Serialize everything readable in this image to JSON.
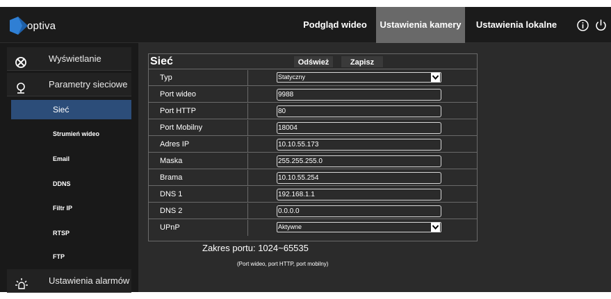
{
  "brand": {
    "name": "optiva",
    "accent": "#2f7fd4"
  },
  "nav": {
    "tabs": [
      {
        "label": "Podgląd wideo",
        "active": false
      },
      {
        "label": "Ustawienia kamery",
        "active": true
      },
      {
        "label": "Ustawienia lokalne",
        "active": false
      }
    ],
    "icons": [
      "info-icon",
      "power-icon"
    ]
  },
  "sidebar": {
    "display": {
      "label": "Wyświetlanie",
      "icon": "aperture-icon"
    },
    "network": {
      "label": "Parametry sieciowe",
      "icon": "globe-icon"
    },
    "sub_items": [
      {
        "label": "Sieć",
        "active": true
      },
      {
        "label": "Strumień wideo"
      },
      {
        "label": "Email"
      },
      {
        "label": "DDNS"
      },
      {
        "label": "Filtr IP"
      },
      {
        "label": "RTSP"
      },
      {
        "label": "FTP"
      }
    ],
    "alarms": {
      "label": "Ustawienia alarmów",
      "icon": "alarm-bulb-icon"
    }
  },
  "form": {
    "title": "Sieć",
    "refresh_label": "Odśwież",
    "save_label": "Zapisz",
    "fields": [
      {
        "label": "Typ",
        "value": "Statyczny",
        "kind": "select"
      },
      {
        "label": "Port wideo",
        "value": "9988"
      },
      {
        "label": "Port HTTP",
        "value": "80"
      },
      {
        "label": "Port Mobilny",
        "value": "18004"
      },
      {
        "label": "Adres IP",
        "value": "10.10.55.173"
      },
      {
        "label": "Maska",
        "value": "255.255.255.0"
      },
      {
        "label": "Brama",
        "value": "10.10.55.254"
      },
      {
        "label": "DNS 1",
        "value": "192.168.1.1"
      },
      {
        "label": "DNS 2",
        "value": "0.0.0.0"
      },
      {
        "label": "UPnP",
        "value": "Aktywne",
        "kind": "select"
      }
    ]
  },
  "notes": {
    "port_range": "Zakres portu: 1024~65535",
    "port_hint": "(Port wideo, port HTTP, port mobilny)"
  },
  "colors": {
    "header_bg": "#1b1b1b",
    "active_tab": "#696969",
    "sidebar_active": "#2c4d79",
    "content_bg": "#2b2b2b"
  }
}
